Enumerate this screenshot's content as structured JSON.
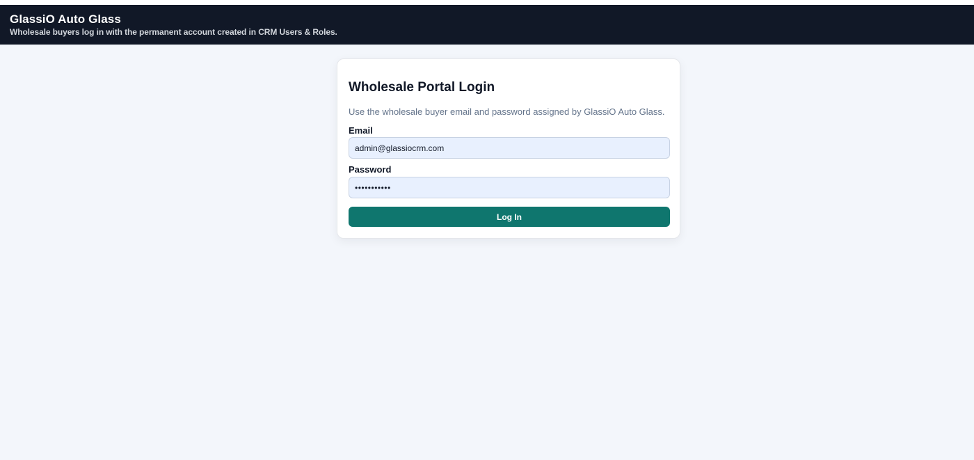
{
  "header": {
    "title": "GlassiO Auto Glass",
    "subtitle": "Wholesale buyers log in with the permanent account created in CRM Users & Roles."
  },
  "login": {
    "title": "Wholesale Portal Login",
    "description": "Use the wholesale buyer email and password assigned by GlassiO Auto Glass.",
    "email_label": "Email",
    "email_value": "admin@glassiocrm.com",
    "password_label": "Password",
    "password_value": "•••••••••••",
    "submit_label": "Log In"
  },
  "colors": {
    "header_bg": "#111827",
    "page_bg": "#f3f6fb",
    "accent": "#0f766e",
    "input_bg": "#e8f0fe"
  }
}
